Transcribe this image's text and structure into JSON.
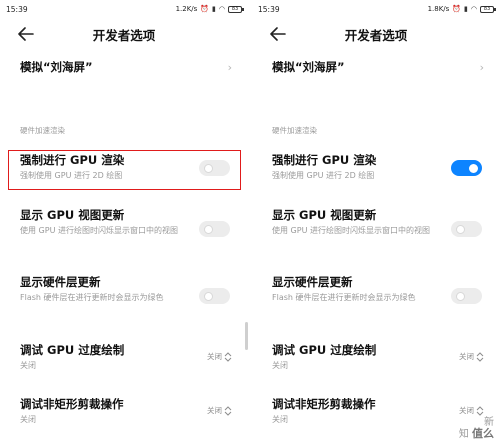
{
  "left": {
    "status": {
      "time": "15:39",
      "speed": "1.2K/s",
      "battery": "83"
    },
    "title": "开发者选项",
    "notch_label": "模拟“刘海屏”",
    "section_label": "硬件加速渲染",
    "items": [
      {
        "title": "强制进行 GPU 渲染",
        "subtitle": "强制使用 GPU 进行 2D 绘图",
        "toggle": false
      },
      {
        "title": "显示 GPU 视图更新",
        "subtitle": "使用 GPU 进行绘图时闪烁显示窗口中的视图",
        "toggle": false
      },
      {
        "title": "显示硬件层更新",
        "subtitle": "Flash 硬件层在进行更新时会显示为绿色",
        "toggle": false
      },
      {
        "title": "调试 GPU 过度绘制",
        "subtitle": "关闭",
        "dropdown": "关闭"
      },
      {
        "title": "调试非矩形剪裁操作",
        "subtitle": "关闭",
        "dropdown": "关闭"
      }
    ]
  },
  "right": {
    "status": {
      "time": "15:39",
      "speed": "1.8K/s",
      "battery": "83"
    },
    "title": "开发者选项",
    "notch_label": "模拟“刘海屏”",
    "section_label": "硬件加速渲染",
    "items": [
      {
        "title": "强制进行 GPU 渲染",
        "subtitle": "强制使用 GPU 进行 2D 绘图",
        "toggle": true
      },
      {
        "title": "显示 GPU 视图更新",
        "subtitle": "使用 GPU 进行绘图时闪烁显示窗口中的视图",
        "toggle": false
      },
      {
        "title": "显示硬件层更新",
        "subtitle": "Flash 硬件层在进行更新时会显示为绿色",
        "toggle": false
      },
      {
        "title": "调试 GPU 过度绘制",
        "subtitle": "关闭",
        "dropdown": "关闭"
      },
      {
        "title": "调试非矩形剪裁操作",
        "subtitle": "关闭",
        "dropdown": "关闭"
      }
    ]
  },
  "watermark": {
    "line1": "新",
    "line2": "知",
    "main": "值么"
  },
  "colors": {
    "accent": "#0d84ff",
    "highlight": "#e01b1b",
    "toggle_off": "#ececec"
  },
  "icons": [
    "back-arrow-icon",
    "chevron-right-icon",
    "up-down-chevron-icon",
    "wifi-icon",
    "signal-icon",
    "battery-icon",
    "alarm-icon"
  ]
}
